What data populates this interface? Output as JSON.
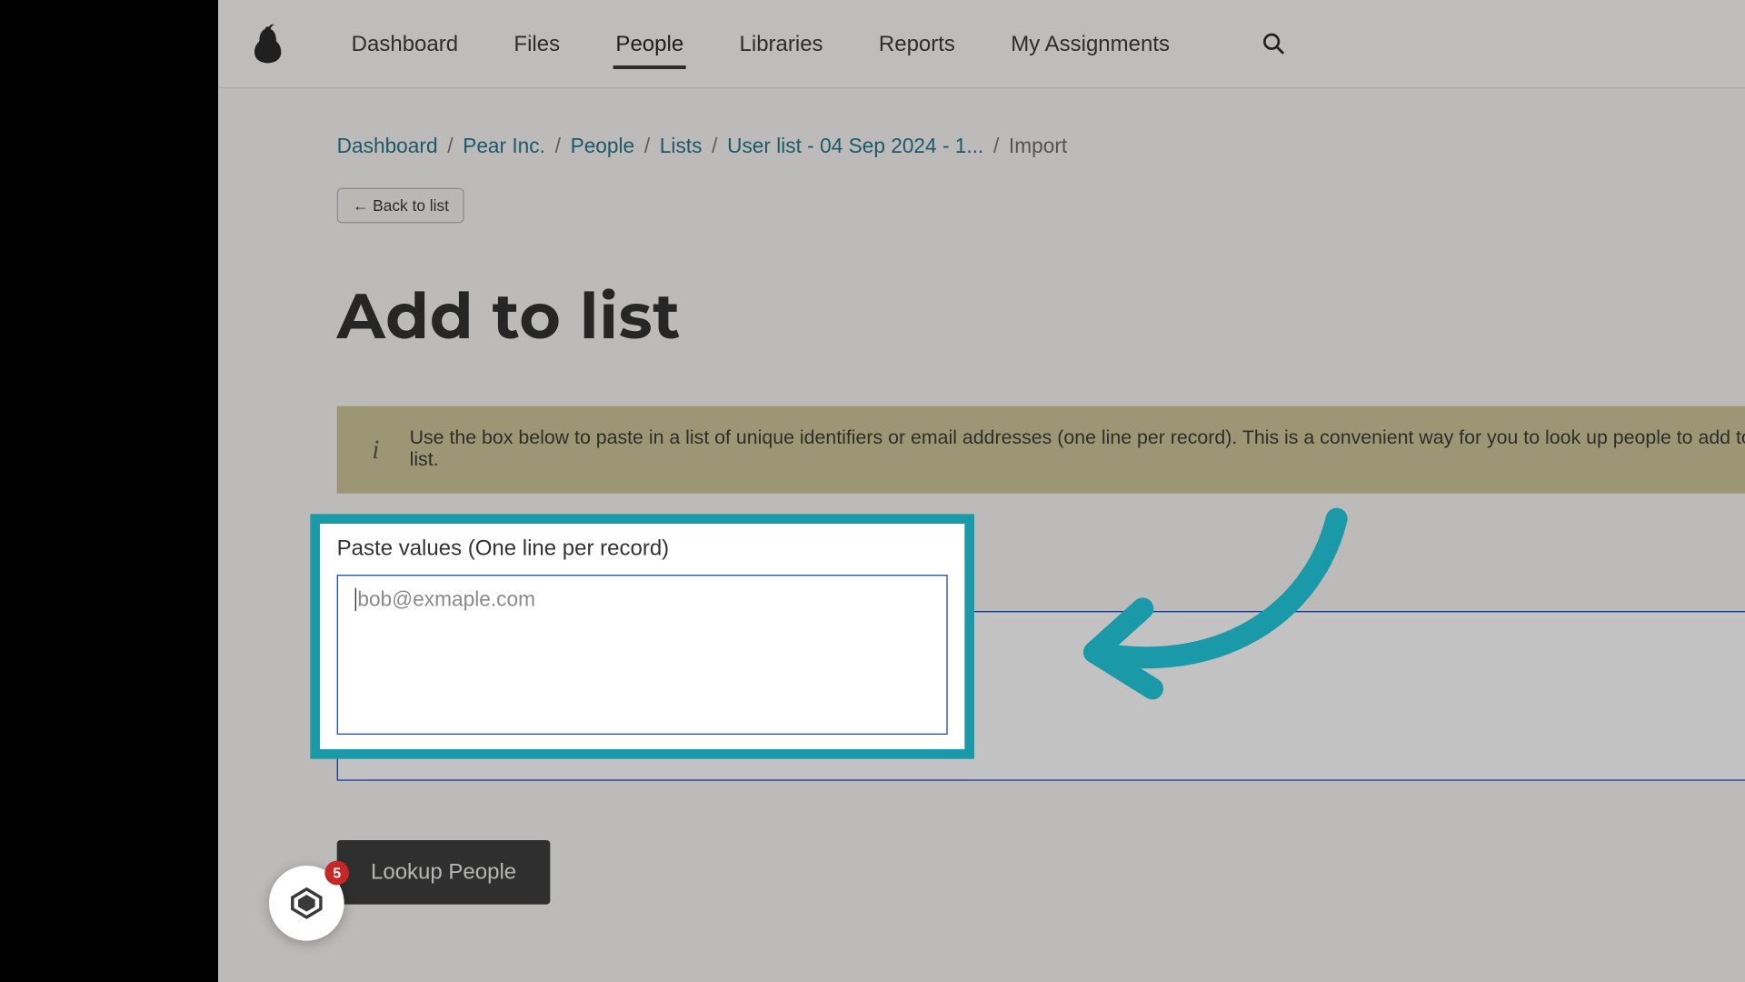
{
  "nav": {
    "items": [
      {
        "label": "Dashboard"
      },
      {
        "label": "Files"
      },
      {
        "label": "People"
      },
      {
        "label": "Libraries"
      },
      {
        "label": "Reports"
      },
      {
        "label": "My Assignments"
      }
    ],
    "active_index": 2
  },
  "breadcrumbs": [
    {
      "label": "Dashboard",
      "link": true
    },
    {
      "label": "Pear Inc.",
      "link": true
    },
    {
      "label": "People",
      "link": true
    },
    {
      "label": "Lists",
      "link": true
    },
    {
      "label": "User list - 04 Sep 2024 - 1...",
      "link": true
    },
    {
      "label": "Import",
      "link": false
    }
  ],
  "back_button": "←  Back to list",
  "page_title": "Add to list",
  "info_text": "Use the box below to paste in a list of unique identifiers or email addresses (one line per record). This is a convenient way for you to look up people to add to this list.",
  "form": {
    "label": "Paste values (One line per record)",
    "placeholder": "bob@exmaple.com",
    "value": ""
  },
  "lookup_button": "Lookup People",
  "widget_badge": "5",
  "colors": {
    "accent_teal": "#1a9aa8",
    "link_teal": "#28758a",
    "info_bg": "#cfc59a",
    "button_dark": "#3f3f3f",
    "input_border": "#1f4fb8"
  }
}
